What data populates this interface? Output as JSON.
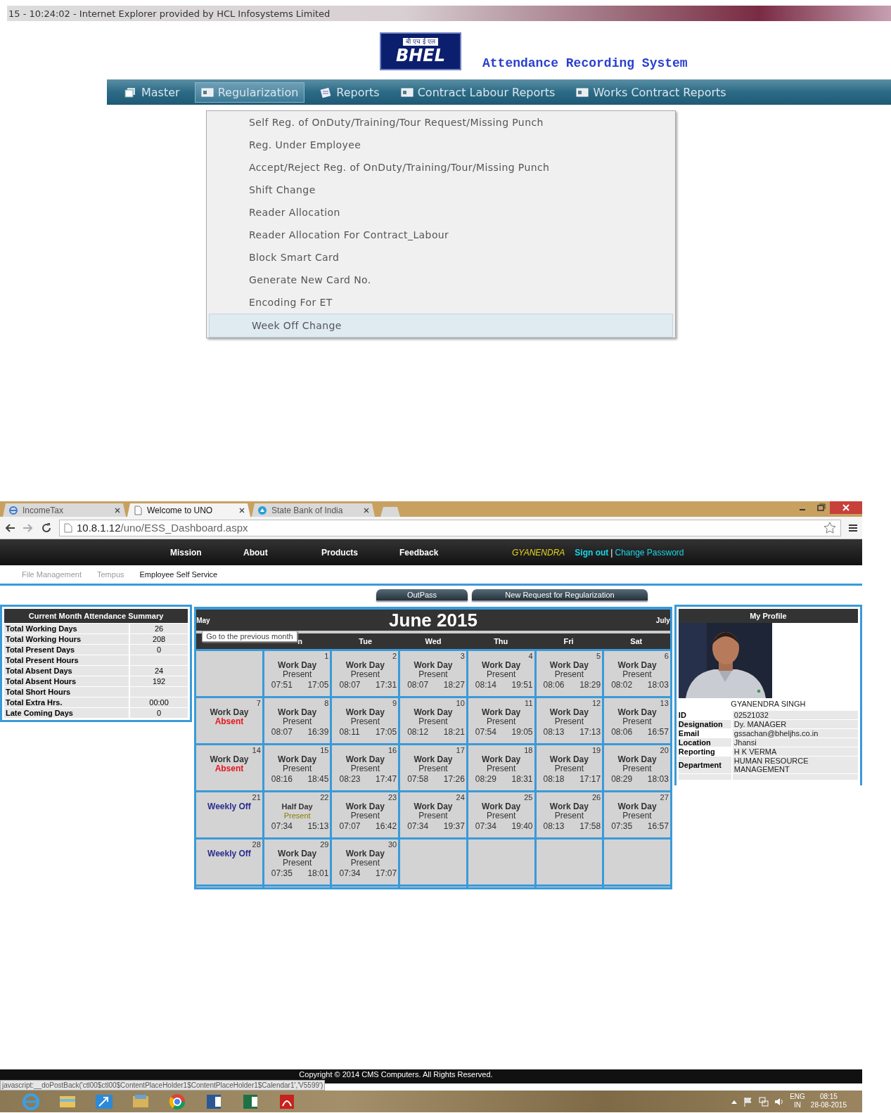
{
  "ie_title": "15 - 10:24:02 - Internet Explorer provided by HCL Infosystems Limited",
  "logo": {
    "hindi": "बी एच ई एल",
    "name": "BHEL"
  },
  "app_title": "Attendance Recording System",
  "menu": [
    {
      "label": "Master",
      "selected": false
    },
    {
      "label": "Regularization",
      "selected": true
    },
    {
      "label": "Reports",
      "selected": false
    },
    {
      "label": "Contract Labour Reports",
      "selected": false
    },
    {
      "label": "Works Contract Reports",
      "selected": false
    }
  ],
  "dropdown": [
    {
      "label": "Self Reg. of OnDuty/Training/Tour Request/Missing Punch",
      "selected": false
    },
    {
      "label": "Reg. Under Employee",
      "selected": false
    },
    {
      "label": "Accept/Reject Reg. of OnDuty/Training/Tour/Missing Punch",
      "selected": false
    },
    {
      "label": "Shift Change",
      "selected": false
    },
    {
      "label": "Reader Allocation",
      "selected": false
    },
    {
      "label": "Reader Allocation For Contract_Labour",
      "selected": false
    },
    {
      "label": "Block Smart Card",
      "selected": false
    },
    {
      "label": "Generate New Card No.",
      "selected": false
    },
    {
      "label": "Encoding For ET",
      "selected": false
    },
    {
      "label": "Week Off Change",
      "selected": true
    }
  ],
  "browser": {
    "tabs": [
      {
        "label": "IncomeTax",
        "selected": false
      },
      {
        "label": "Welcome to UNO",
        "selected": true
      },
      {
        "label": "State Bank of India",
        "selected": false
      }
    ],
    "address": {
      "host": "10.8.1.12",
      "path": "/uno/ESS_Dashboard.aspx"
    }
  },
  "nav": [
    "Mission",
    "About",
    "Products",
    "Feedback"
  ],
  "user": "GYANENDRA",
  "sign_out": "Sign out",
  "separator": "|",
  "change_password": "Change Password",
  "subnav": [
    {
      "label": "File Management",
      "selected": false
    },
    {
      "label": "Tempus",
      "selected": false
    },
    {
      "label": "Employee Self Service",
      "selected": true
    }
  ],
  "buttons": [
    "OutPass",
    "New Request for Regularization"
  ],
  "summary": {
    "title": "Current Month Attendance Summary",
    "rows": [
      {
        "label": "Total Working Days",
        "value": "26"
      },
      {
        "label": "Total Working Hours",
        "value": "208"
      },
      {
        "label": "Total Present Days",
        "value": "0"
      },
      {
        "label": "Total Present Hours"
      },
      {
        "label": "Total Absent Days",
        "value": "24"
      },
      {
        "label": "Total Absent Hours",
        "value": "192"
      },
      {
        "label": "Total Short Hours"
      },
      {
        "label": "Total Extra Hrs.",
        "value": "00:00"
      },
      {
        "label": "Late Coming Days",
        "value": "0"
      }
    ]
  },
  "calendar": {
    "prev": "May",
    "title": "June 2015",
    "next": "July",
    "tooltip": "Go to the previous month",
    "weekdays": [
      "n",
      "Tue",
      "Wed",
      "Thu",
      "Fri",
      "Sat"
    ],
    "weeks": [
      [
        {
          "kind": "empty"
        },
        {
          "kind": "work",
          "day": "1",
          "label": "Work Day",
          "status": "Present",
          "in": "07:51",
          "out": "17:05"
        },
        {
          "kind": "work",
          "day": "2",
          "label": "Work Day",
          "status": "Present",
          "in": "08:07",
          "out": "17:31"
        },
        {
          "kind": "work",
          "day": "3",
          "label": "Work Day",
          "status": "Present",
          "in": "08:07",
          "out": "18:27"
        },
        {
          "kind": "work",
          "day": "4",
          "label": "Work Day",
          "status": "Present",
          "in": "08:14",
          "out": "19:51"
        },
        {
          "kind": "work",
          "day": "5",
          "label": "Work Day",
          "status": "Present",
          "in": "08:06",
          "out": "18:29"
        },
        {
          "kind": "work",
          "day": "6",
          "label": "Work Day",
          "status": "Present",
          "in": "08:02",
          "out": "18:03"
        }
      ],
      [
        {
          "kind": "absent",
          "day": "7",
          "label": "Work Day",
          "status": "Absent"
        },
        {
          "kind": "work",
          "day": "8",
          "label": "Work Day",
          "status": "Present",
          "in": "08:07",
          "out": "16:39"
        },
        {
          "kind": "work",
          "day": "9",
          "label": "Work Day",
          "status": "Present",
          "in": "08:11",
          "out": "17:05"
        },
        {
          "kind": "work",
          "day": "10",
          "label": "Work Day",
          "status": "Present",
          "in": "08:12",
          "out": "18:21"
        },
        {
          "kind": "work",
          "day": "11",
          "label": "Work Day",
          "status": "Present",
          "in": "07:54",
          "out": "19:05"
        },
        {
          "kind": "work",
          "day": "12",
          "label": "Work Day",
          "status": "Present",
          "in": "08:13",
          "out": "17:13"
        },
        {
          "kind": "work",
          "day": "13",
          "label": "Work Day",
          "status": "Present",
          "in": "08:06",
          "out": "16:57"
        }
      ],
      [
        {
          "kind": "absent",
          "day": "14",
          "label": "Work Day",
          "status": "Absent"
        },
        {
          "kind": "work",
          "day": "15",
          "label": "Work Day",
          "status": "Present",
          "in": "08:16",
          "out": "18:45"
        },
        {
          "kind": "work",
          "day": "16",
          "label": "Work Day",
          "status": "Present",
          "in": "08:23",
          "out": "17:47"
        },
        {
          "kind": "work",
          "day": "17",
          "label": "Work Day",
          "status": "Present",
          "in": "07:58",
          "out": "17:26"
        },
        {
          "kind": "work",
          "day": "18",
          "label": "Work Day",
          "status": "Present",
          "in": "08:29",
          "out": "18:31"
        },
        {
          "kind": "work",
          "day": "19",
          "label": "Work Day",
          "status": "Present",
          "in": "08:18",
          "out": "17:17"
        },
        {
          "kind": "work",
          "day": "20",
          "label": "Work Day",
          "status": "Present",
          "in": "08:29",
          "out": "18:03"
        }
      ],
      [
        {
          "kind": "off",
          "day": "21",
          "label": "Weekly Off"
        },
        {
          "kind": "half",
          "day": "22",
          "label": "Half Day",
          "status": "Present",
          "in": "07:34",
          "out": "15:13"
        },
        {
          "kind": "work",
          "day": "23",
          "label": "Work Day",
          "status": "Present",
          "in": "07:07",
          "out": "16:42"
        },
        {
          "kind": "work",
          "day": "24",
          "label": "Work Day",
          "status": "Present",
          "in": "07:34",
          "out": "19:37"
        },
        {
          "kind": "work",
          "day": "25",
          "label": "Work Day",
          "status": "Present",
          "in": "07:34",
          "out": "19:40"
        },
        {
          "kind": "work",
          "day": "26",
          "label": "Work Day",
          "status": "Present",
          "in": "08:13",
          "out": "17:58"
        },
        {
          "kind": "work",
          "day": "27",
          "label": "Work Day",
          "status": "Present",
          "in": "07:35",
          "out": "16:57"
        }
      ],
      [
        {
          "kind": "off",
          "day": "28",
          "label": "Weekly Off"
        },
        {
          "kind": "work",
          "day": "29",
          "label": "Work Day",
          "status": "Present",
          "in": "07:35",
          "out": "18:01"
        },
        {
          "kind": "work",
          "day": "30",
          "label": "Work Day",
          "status": "Present",
          "in": "07:34",
          "out": "17:07"
        },
        {
          "kind": "empty"
        },
        {
          "kind": "empty"
        },
        {
          "kind": "empty"
        },
        {
          "kind": "empty"
        }
      ],
      [
        {
          "kind": "empty"
        },
        {
          "kind": "empty"
        },
        {
          "kind": "empty"
        },
        {
          "kind": "empty"
        },
        {
          "kind": "empty"
        },
        {
          "kind": "empty"
        },
        {
          "kind": "empty"
        }
      ]
    ]
  },
  "profile": {
    "title": "My Profile",
    "name": "GYANENDRA SINGH",
    "rows": [
      {
        "label": "ID",
        "value": "02521032"
      },
      {
        "label": "Designation",
        "value": "Dy. MANAGER"
      },
      {
        "label": "Email",
        "value": "gssachan@bheljhs.co.in"
      },
      {
        "label": "Location",
        "value": "Jhansi"
      },
      {
        "label": "Reporting",
        "value": "H K VERMA"
      },
      {
        "label": "Department",
        "value": "HUMAN RESOURCE MANAGEMENT"
      }
    ]
  },
  "footer": "Copyright © 2014 CMS Computers. All Rights Reserved.",
  "status_text": "javascript:__doPostBack('ctl00$ctl00$ContentPlaceHolder1$ContentPlaceHolder1$Calendar1','V5599')",
  "taskbar": {
    "language": "ENG",
    "region": "IN",
    "time": "08:15",
    "date": "28-08-2015"
  }
}
